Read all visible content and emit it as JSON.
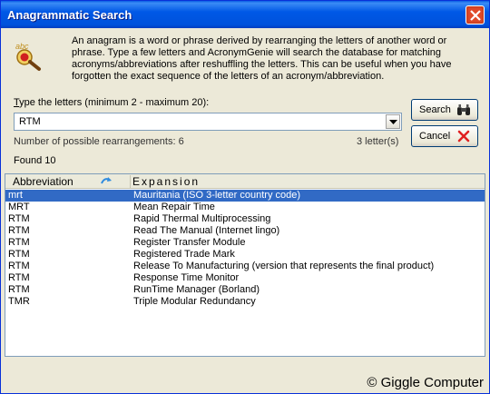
{
  "window": {
    "title": "Anagrammatic Search"
  },
  "description": "An anagram is a word or phrase derived by rearranging the letters of another word or phrase. Type a few letters and AcronymGenie will search the database for matching acronyms/abbreviations after reshuffling the letters. This can be useful when you have forgotten the exact sequence of the letters of an acronym/abbreviation.",
  "input": {
    "label_first": "T",
    "label_rest": "ype the letters (minimum 2 - maximum 20):",
    "value": "RTM"
  },
  "stats": {
    "rearrangements": "Number of possible rearrangements:  6",
    "letters": "3 letter(s)",
    "found": "Found 10"
  },
  "buttons": {
    "search": "Search",
    "cancel": "Cancel"
  },
  "table": {
    "columns": [
      "Abbreviation",
      "Expansion"
    ],
    "rows": [
      {
        "abbr": "mrt",
        "exp": "Mauritania (ISO 3-letter country code)",
        "selected": true
      },
      {
        "abbr": "MRT",
        "exp": "Mean Repair Time"
      },
      {
        "abbr": "RTM",
        "exp": "Rapid Thermal Multiprocessing"
      },
      {
        "abbr": "RTM",
        "exp": "Read The Manual (Internet lingo)"
      },
      {
        "abbr": "RTM",
        "exp": "Register Transfer Module"
      },
      {
        "abbr": "RTM",
        "exp": "Registered Trade Mark"
      },
      {
        "abbr": "RTM",
        "exp": "Release To Manufacturing (version that represents the final product)"
      },
      {
        "abbr": "RTM",
        "exp": "Response Time Monitor"
      },
      {
        "abbr": "RTM",
        "exp": "RunTime Manager (Borland)"
      },
      {
        "abbr": "TMR",
        "exp": "Triple Modular Redundancy"
      }
    ]
  },
  "copyright": "© Giggle Computer",
  "colors": {
    "titlebar": "#0058e6",
    "selection": "#316ac5",
    "close": "#e04a2a"
  }
}
